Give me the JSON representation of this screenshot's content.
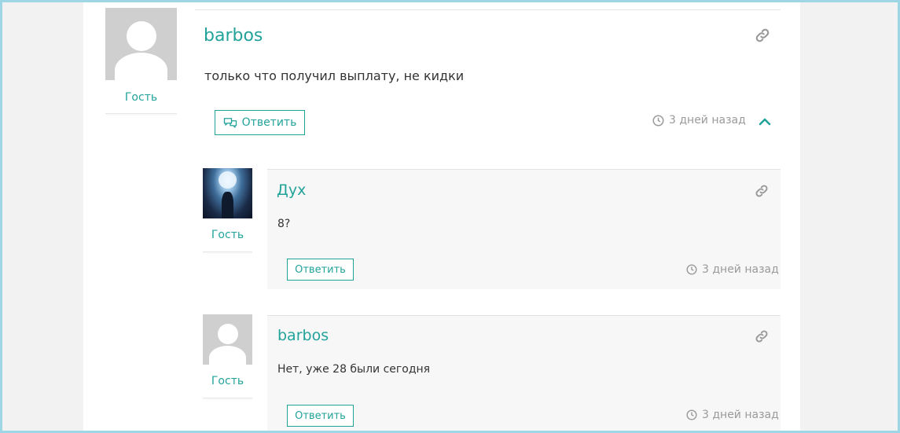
{
  "comments": [
    {
      "author": "barbos",
      "role": "Гость",
      "text": "только что получил выплату, не кидки",
      "reply_label": "Ответить",
      "time": "3 дней назад",
      "avatar": "default-avatar"
    },
    {
      "author": "Дух",
      "role": "Гость",
      "text": "8?",
      "reply_label": "Ответить",
      "time": "3 дней назад",
      "avatar": "photo-avatar"
    },
    {
      "author": "barbos",
      "role": "Гость",
      "text": "Нет, уже 28 были сегодня",
      "reply_label": "Ответить",
      "time": "3 дней назад",
      "avatar": "default-avatar"
    }
  ],
  "icons": {
    "link": "link-icon",
    "reply": "chat-bubbles-icon",
    "clock": "clock-icon",
    "collapse": "chevron-up-icon"
  },
  "colors": {
    "accent": "#22a39a",
    "muted": "#9a9a9a",
    "reply_bg": "#f7f7f7",
    "frame": "#9fd6e6"
  }
}
